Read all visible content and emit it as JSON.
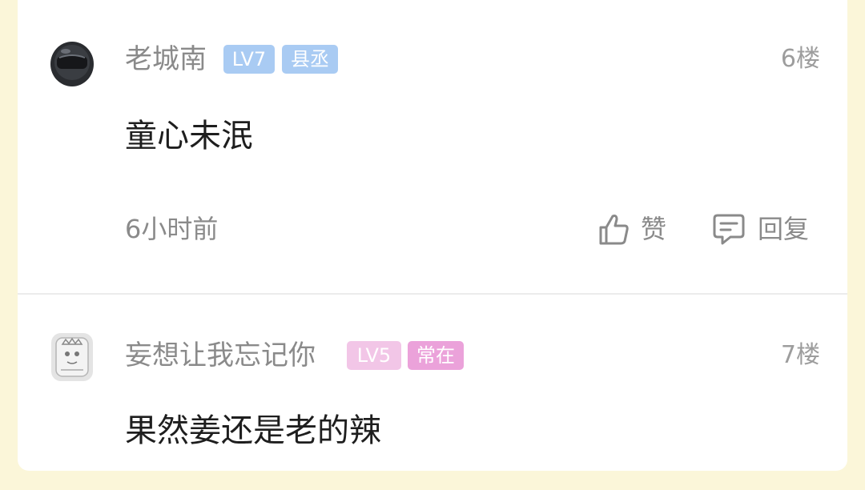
{
  "comments": [
    {
      "username": "老城南",
      "level": "LV7",
      "title": "县丞",
      "floor": "6楼",
      "content": "童心未泯",
      "time": "6小时前",
      "like_label": "赞",
      "reply_label": "回复",
      "level_color": "#a9cbf3",
      "title_color": "#a9cbf3"
    },
    {
      "username": "妄想让我忘记你",
      "level": "LV5",
      "title": "常在",
      "floor": "7楼",
      "content": "果然姜还是老的辣",
      "level_color": "#f2c6e7",
      "title_color": "#eba2da"
    }
  ],
  "icons": [
    "helmet-avatar",
    "cartoon-avatar",
    "thumbs-up-icon",
    "comment-bubble-icon"
  ],
  "colors": {
    "page_bg": "#fbf6d9",
    "card_bg": "#ffffff",
    "username": "#8a8a8a",
    "content": "#1e1e1e"
  }
}
